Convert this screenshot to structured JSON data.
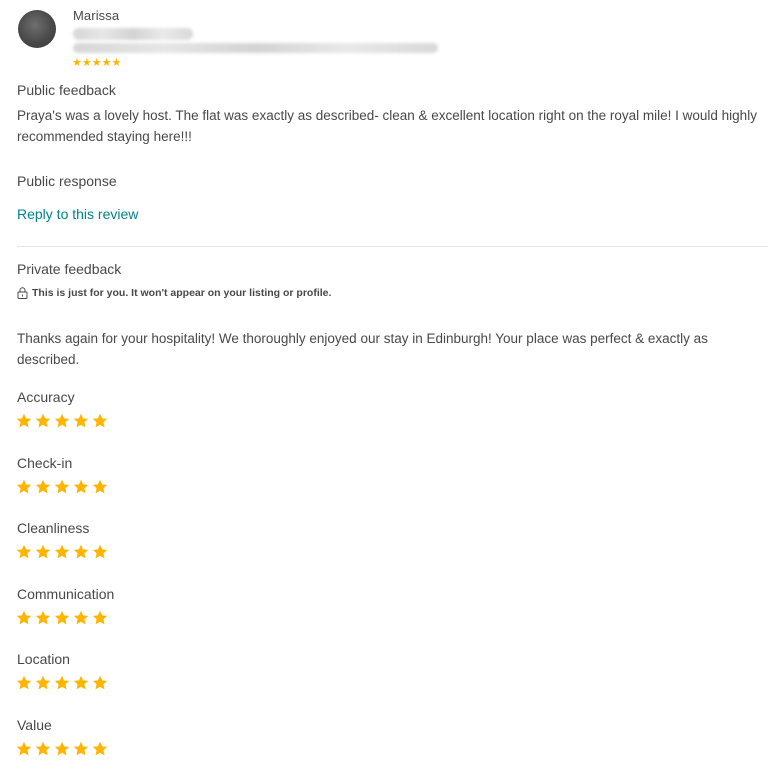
{
  "reviewer": {
    "name": "Marissa",
    "overall_rating": 5,
    "overall_stars": "★★★★★"
  },
  "public_feedback": {
    "heading": "Public feedback",
    "text": "Praya's was a lovely host. The flat was exactly as described- clean & excellent location right on the royal mile! I would highly recommended staying here!!!"
  },
  "public_response": {
    "heading": "Public response",
    "link_label": "Reply to this review"
  },
  "private_feedback": {
    "heading": "Private feedback",
    "note": "This is just for you. It won't appear on your listing or profile.",
    "text": "Thanks again for your hospitality! We thoroughly enjoyed our stay in Edinburgh! Your place was perfect & exactly as described."
  },
  "ratings": [
    {
      "label": "Accuracy",
      "stars": 5
    },
    {
      "label": "Check-in",
      "stars": 5
    },
    {
      "label": "Cleanliness",
      "stars": 5
    },
    {
      "label": "Communication",
      "stars": 5
    },
    {
      "label": "Location",
      "stars": 5
    },
    {
      "label": "Value",
      "stars": 5
    }
  ],
  "colors": {
    "star": "#ffb400",
    "link": "#008489",
    "text": "#484848",
    "divider": "#e4e4e4"
  },
  "icons": {
    "lock": "lock-icon",
    "star": "star-icon"
  }
}
